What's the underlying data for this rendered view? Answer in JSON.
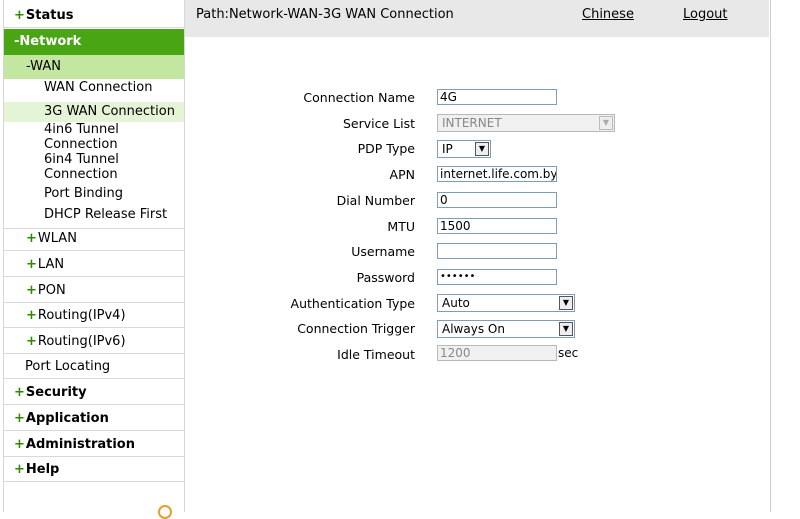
{
  "nav": {
    "status": "Status",
    "network": "Network",
    "wan": "WAN",
    "wan_items": [
      "WAN Connection",
      "3G WAN Connection",
      "4in6 Tunnel",
      "Connection",
      "6in4 Tunnel",
      "Connection",
      "Port Binding",
      "DHCP Release First"
    ],
    "network_items": [
      "WLAN",
      "LAN",
      "PON",
      "Routing(IPv4)",
      "Routing(IPv6)",
      "Port Locating"
    ],
    "security": "Security",
    "application": "Application",
    "administration": "Administration",
    "help": "Help",
    "plus": "+",
    "minus": "-",
    "highlight_color": "#49a514"
  },
  "header": {
    "path": "Path:Network-WAN-3G WAN Connection",
    "chinese": "Chinese",
    "logout": "Logout"
  },
  "form": {
    "connection_name_label": "Connection Name",
    "connection_name": "4G",
    "service_list_label": "Service List",
    "service_list": "INTERNET",
    "pdp_type_label": "PDP Type",
    "pdp_type": "IP",
    "apn_label": "APN",
    "apn": "internet.life.com.by",
    "dial_number_label": "Dial Number",
    "dial_number": "0",
    "mtu_label": "MTU",
    "mtu": "1500",
    "username_label": "Username",
    "username": "",
    "password_label": "Password",
    "password": "••••••",
    "auth_type_label": "Authentication Type",
    "auth_type": "Auto",
    "conn_trigger_label": "Connection Trigger",
    "conn_trigger": "Always On",
    "idle_timeout_label": "Idle Timeout",
    "idle_timeout": "1200",
    "idle_timeout_unit": "sec"
  }
}
